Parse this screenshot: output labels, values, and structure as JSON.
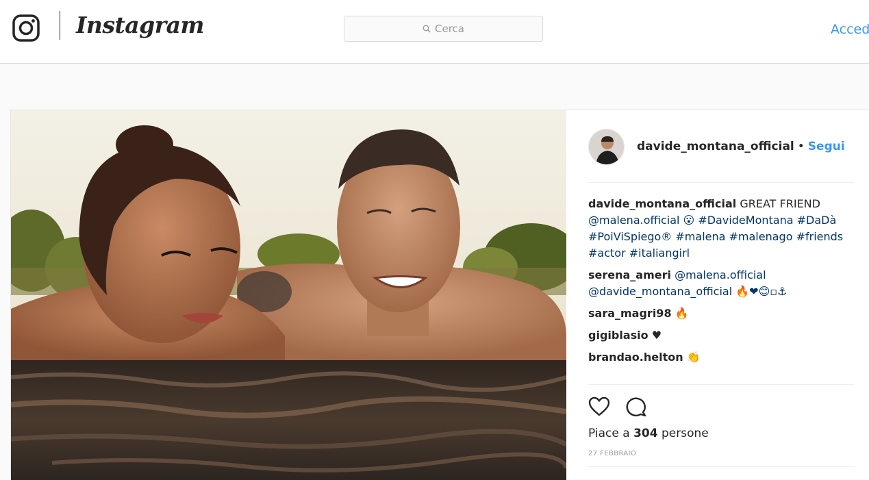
{
  "header": {
    "brand_icon": "camera-glyph-icon",
    "wordmark": "Instagram",
    "search_placeholder": "Cerca",
    "search_icon": "search-icon",
    "login_label": "Accedi",
    "accent_color": "#3897f0"
  },
  "post": {
    "author": "davide_montana_official",
    "separator": "•",
    "follow_label": "Segui",
    "photo_icon": "post-photo",
    "comments": [
      {
        "user": "davide_montana_official",
        "text": " GREAT FRIEND ",
        "tags": "@malena.official 😮 #DavideMontana #DaDà #PoiViSpiego® #malena #malenago #friends #actor #italiangirl"
      },
      {
        "user": "serena_ameri",
        "text": " ",
        "tags": "@malena.official @davide_montana_official 🔥❤😊▫⚓"
      },
      {
        "user": "sara_magri98",
        "text": " 🔥",
        "tags": ""
      },
      {
        "user": "gigiblasio",
        "text": " ♥",
        "tags": ""
      },
      {
        "user": "brandao.helton",
        "text": " 👏",
        "tags": ""
      }
    ],
    "like_icon": "heart-icon",
    "comment_icon": "comment-icon",
    "likes_prefix": "Piace a ",
    "likes_count": "304",
    "likes_suffix": " persone",
    "date": "27 FEBBRAIO"
  }
}
